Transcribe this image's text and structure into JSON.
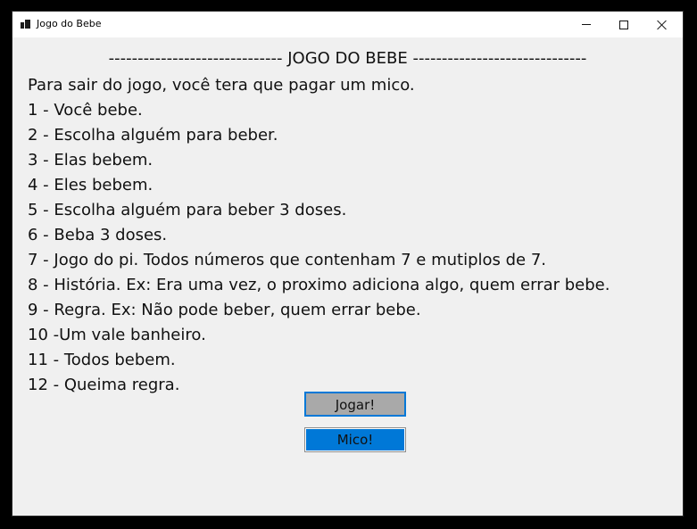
{
  "window": {
    "title": "Jogo do Bebe",
    "icon": "app-icon"
  },
  "content": {
    "heading": "------------------------------ JOGO DO BEBE ------------------------------",
    "intro": "Para sair do jogo, você tera que pagar um mico.",
    "rules": [
      "1 - Você bebe.",
      "2 - Escolha alguém para beber.",
      "3 - Elas bebem.",
      "4 - Eles bebem.",
      "5 - Escolha alguém para beber 3 doses.",
      "6 - Beba 3 doses.",
      "7 - Jogo do pi. Todos números que contenham 7 e mutiplos de 7.",
      "8 - História. Ex: Era uma vez, o proximo adiciona algo, quem errar bebe.",
      "9 - Regra. Ex: Não pode beber, quem errar bebe.",
      "10 -Um vale banheiro.",
      "11 - Todos bebem.",
      "12 - Queima regra."
    ]
  },
  "buttons": {
    "jogar": "Jogar!",
    "mico": "Mico!"
  },
  "colors": {
    "accent": "#0078d7",
    "window_bg": "#f0f0f0",
    "jogar_bg": "#a9a9a9"
  }
}
